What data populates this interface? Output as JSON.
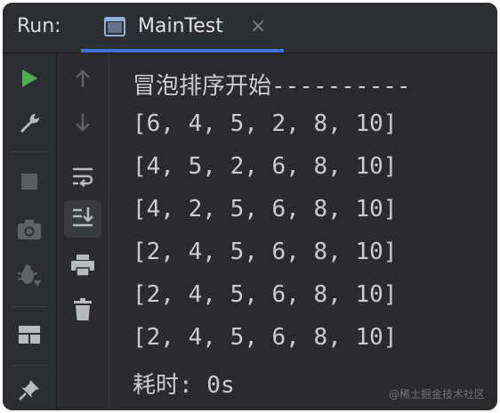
{
  "titlebar": {
    "run_label": "Run:",
    "tab_label": "MainTest",
    "tab_close": "×"
  },
  "left_toolbar": {
    "icons": [
      "play-icon",
      "wrench-icon",
      "stop-icon",
      "camera-icon",
      "bug-icon",
      "layout-icon",
      "pin-icon"
    ]
  },
  "mid_toolbar": {
    "icons": [
      "arrow-up-icon",
      "arrow-down-icon",
      "soft-wrap-icon",
      "scroll-to-end-icon",
      "print-icon",
      "trash-icon"
    ]
  },
  "console": {
    "lines": [
      "冒泡排序开始----------",
      "[6, 4, 5, 2, 8, 10]",
      "[4, 5, 2, 6, 8, 10]",
      "[4, 2, 5, 6, 8, 10]",
      "[2, 4, 5, 6, 8, 10]",
      "[2, 4, 5, 6, 8, 10]",
      "[2, 4, 5, 6, 8, 10]",
      "耗时: 0s"
    ]
  },
  "watermark": "@稀土掘金技术社区",
  "colors": {
    "background": "#2b2b2d",
    "accent": "#3d72d6",
    "play": "#4caf50",
    "text": "#c9ccd1"
  }
}
